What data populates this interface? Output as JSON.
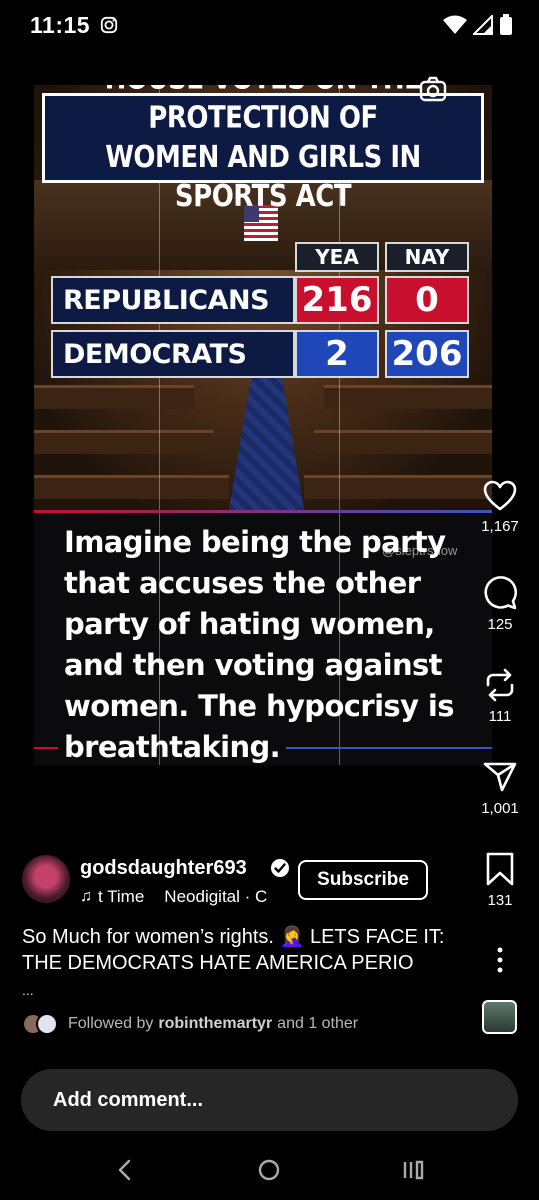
{
  "status_bar": {
    "time": "11:15"
  },
  "post": {
    "headline_line1": "HOUSE VOTES ON THE PROTECTION OF",
    "headline_line2": "WOMEN AND GIRLS IN SPORTS ACT",
    "vote_table": {
      "columns": [
        "YEA",
        "NAY"
      ],
      "rows": [
        {
          "party": "REPUBLICANS",
          "yea": "216",
          "nay": "0"
        },
        {
          "party": "DEMOCRATS",
          "yea": "2",
          "nay": "206"
        }
      ]
    },
    "caption_lines": [
      "Imagine being the party",
      "that accuses the other",
      "party of hating women,",
      "and then voting against",
      "women. The hypocrisy is",
      "breathtaking."
    ],
    "watermark": "@sleptrshow"
  },
  "actions": {
    "likes": "1,167",
    "comments": "125",
    "reposts": "111",
    "shares": "1,001",
    "saves": "131"
  },
  "author": {
    "username": "godsdaughter693",
    "music_title": "t Time",
    "music_artist": "Neodigital · C",
    "subscribe_label": "Subscribe"
  },
  "description": {
    "text": "So Much for women’s rights. 🤦‍♀️ LETS FACE IT: THE DEMOCRATS HATE AMERICA PERIO",
    "more": "..."
  },
  "followed_by": {
    "prefix": "Followed by",
    "user": "robinthemartyr",
    "suffix": "and 1 other"
  },
  "comment_input": {
    "placeholder": "Add comment..."
  },
  "colors": {
    "red": "#c8102e",
    "blue": "#1f47b8",
    "navy": "#0c1a44"
  }
}
